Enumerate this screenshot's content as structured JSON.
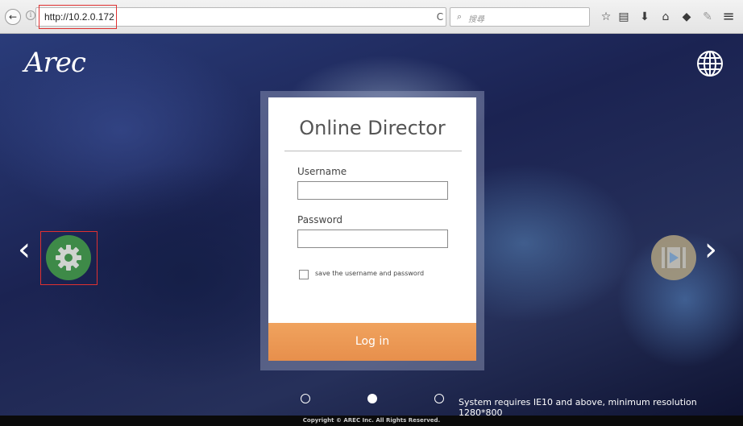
{
  "browser": {
    "url": "http://10.2.0.172",
    "search_placeholder": "搜尋",
    "icons": [
      "back-icon",
      "info-icon",
      "reload-icon",
      "search-icon",
      "bookmark-star-icon",
      "reading-list-icon",
      "download-icon",
      "home-icon",
      "pocket-icon",
      "extension-icon",
      "menu-icon"
    ],
    "glyphs": {
      "back": "←",
      "info": "i",
      "reload": "C",
      "search": "⌕",
      "star": "☆",
      "reading": "▤",
      "download": "⬇",
      "home": "⌂",
      "pocket": "◆",
      "ext": "✎",
      "menu": "≡"
    }
  },
  "page": {
    "logo": "Arec",
    "title": "Online Director",
    "username_label": "Username",
    "password_label": "Password",
    "username_value": "",
    "password_value": "",
    "remember_label": "save the username and password",
    "login_label": "Log in",
    "left_arrow": "‹",
    "right_arrow": "›",
    "system_requirements": "System requires IE10 and above, minimum resolution 1280*800",
    "copyright": "Copyright © AREC Inc. All Rights Reserved.",
    "carousel_dots": 3,
    "active_dot": 2,
    "colors": {
      "login_button": "#e8924f",
      "gear_bg": "#3e8a48",
      "highlight": "#e03030"
    }
  }
}
